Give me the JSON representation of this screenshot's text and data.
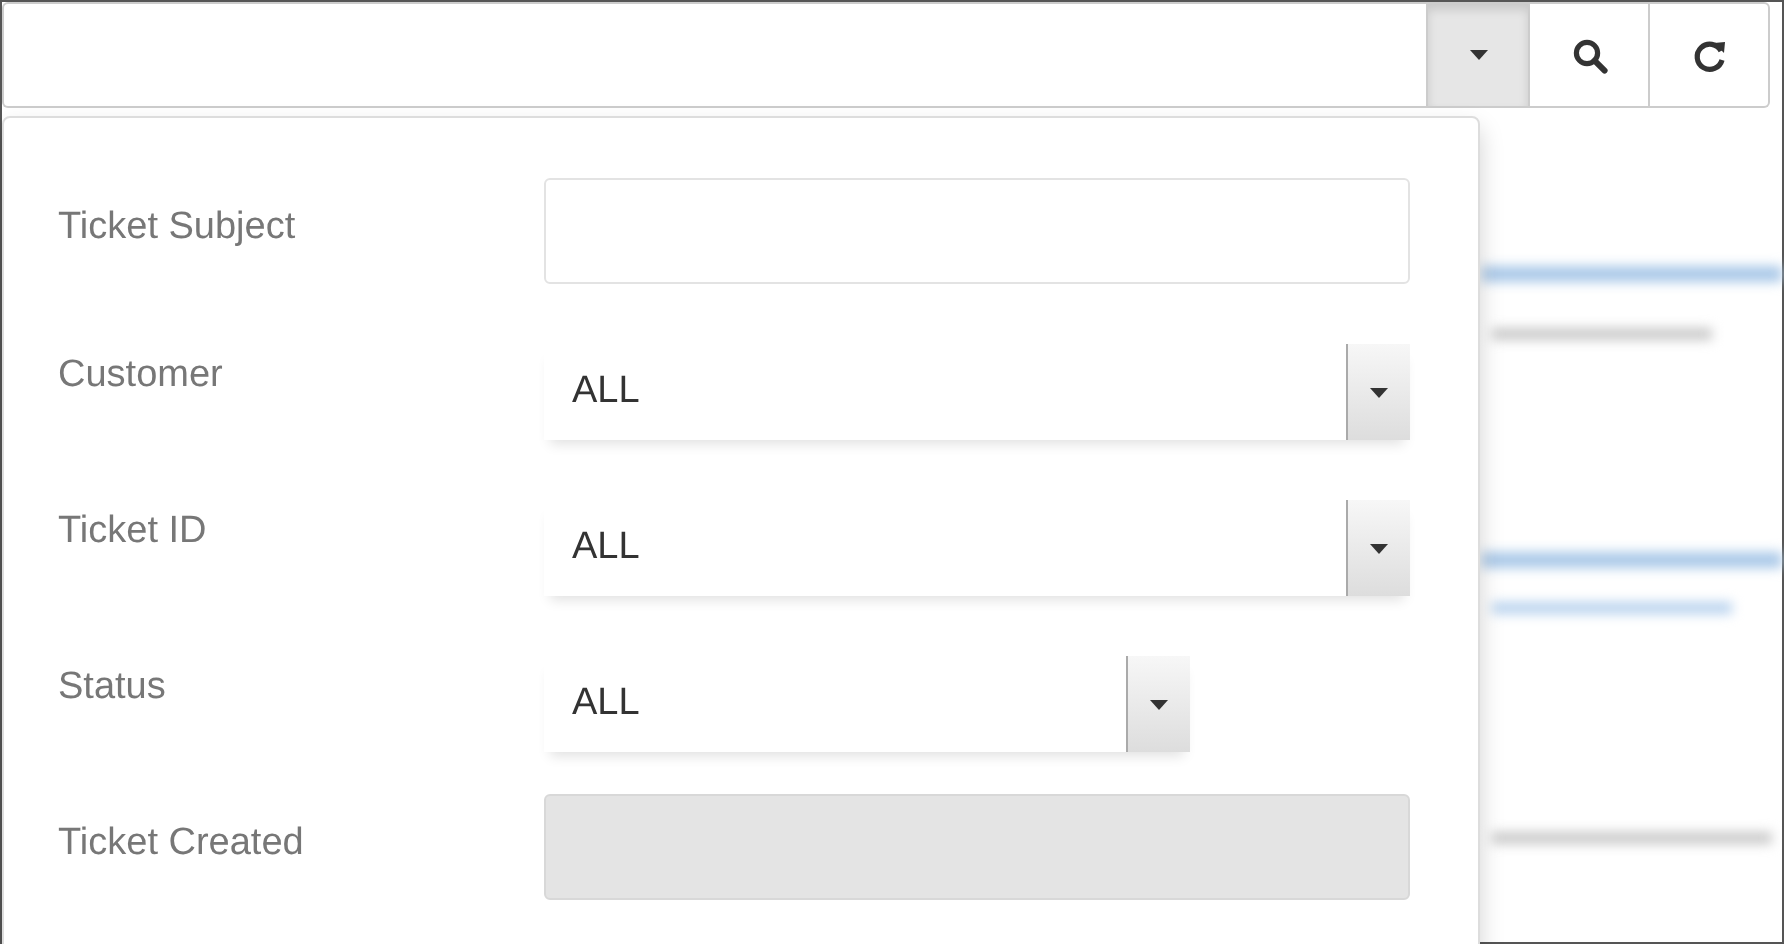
{
  "toolbar": {
    "buttons": [
      {
        "kind": "toggle",
        "expanded": true
      },
      {
        "kind": "search",
        "expanded": false
      },
      {
        "kind": "refresh",
        "expanded": false
      }
    ]
  },
  "filters": [
    {
      "kind": "text",
      "label": "Ticket Subject",
      "disabled": false
    },
    {
      "kind": "select",
      "label": "Customer",
      "value": "ALL",
      "disabled": false
    },
    {
      "kind": "select",
      "label": "Ticket ID",
      "value": "ALL",
      "disabled": false
    },
    {
      "kind": "select",
      "label": "Status",
      "value": "ALL",
      "disabled": false
    },
    {
      "kind": "text",
      "label": "Ticket Created",
      "disabled": true
    }
  ]
}
